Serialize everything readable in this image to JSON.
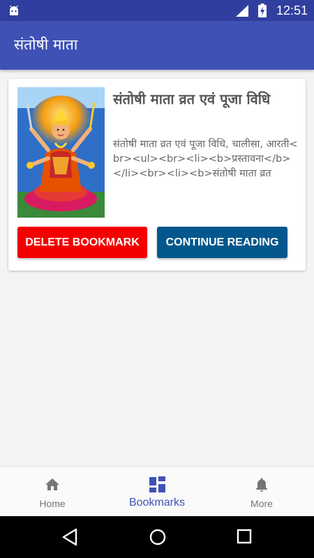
{
  "status_bar": {
    "time": "12:51",
    "icons": [
      "android-icon",
      "signal-icon",
      "battery-charging-icon"
    ]
  },
  "app_bar": {
    "title": "संतोषी माता"
  },
  "bookmark_card": {
    "image_subject": "santoshi-mata-image",
    "heading": "संतोषी माता व्रत एवं पूजा विधि",
    "description": "संतोषी माता व्रत एवं पूजा विधि, चालीसा, आरती<br><ul><br><li><b>प्रस्तावना</b></li><br><li><b>संतोषी माता व्रत",
    "delete_label": "DELETE BOOKMARK",
    "continue_label": "CONTINUE READING",
    "colors": {
      "delete": "#f40000",
      "continue": "#04578c"
    }
  },
  "bottom_nav": {
    "items": [
      {
        "label": "Home",
        "icon": "home-icon",
        "active": false
      },
      {
        "label": "Bookmarks",
        "icon": "dashboard-icon",
        "active": true
      },
      {
        "label": "More",
        "icon": "bell-icon",
        "active": false
      }
    ],
    "colors": {
      "active": "#3f51b5",
      "inactive": "#757575"
    }
  },
  "system_nav": {
    "icons": [
      "back-icon",
      "home-circle-icon",
      "recents-icon"
    ]
  },
  "theme": {
    "primary": "#3f51b5",
    "primary_dark": "#303f9f"
  }
}
